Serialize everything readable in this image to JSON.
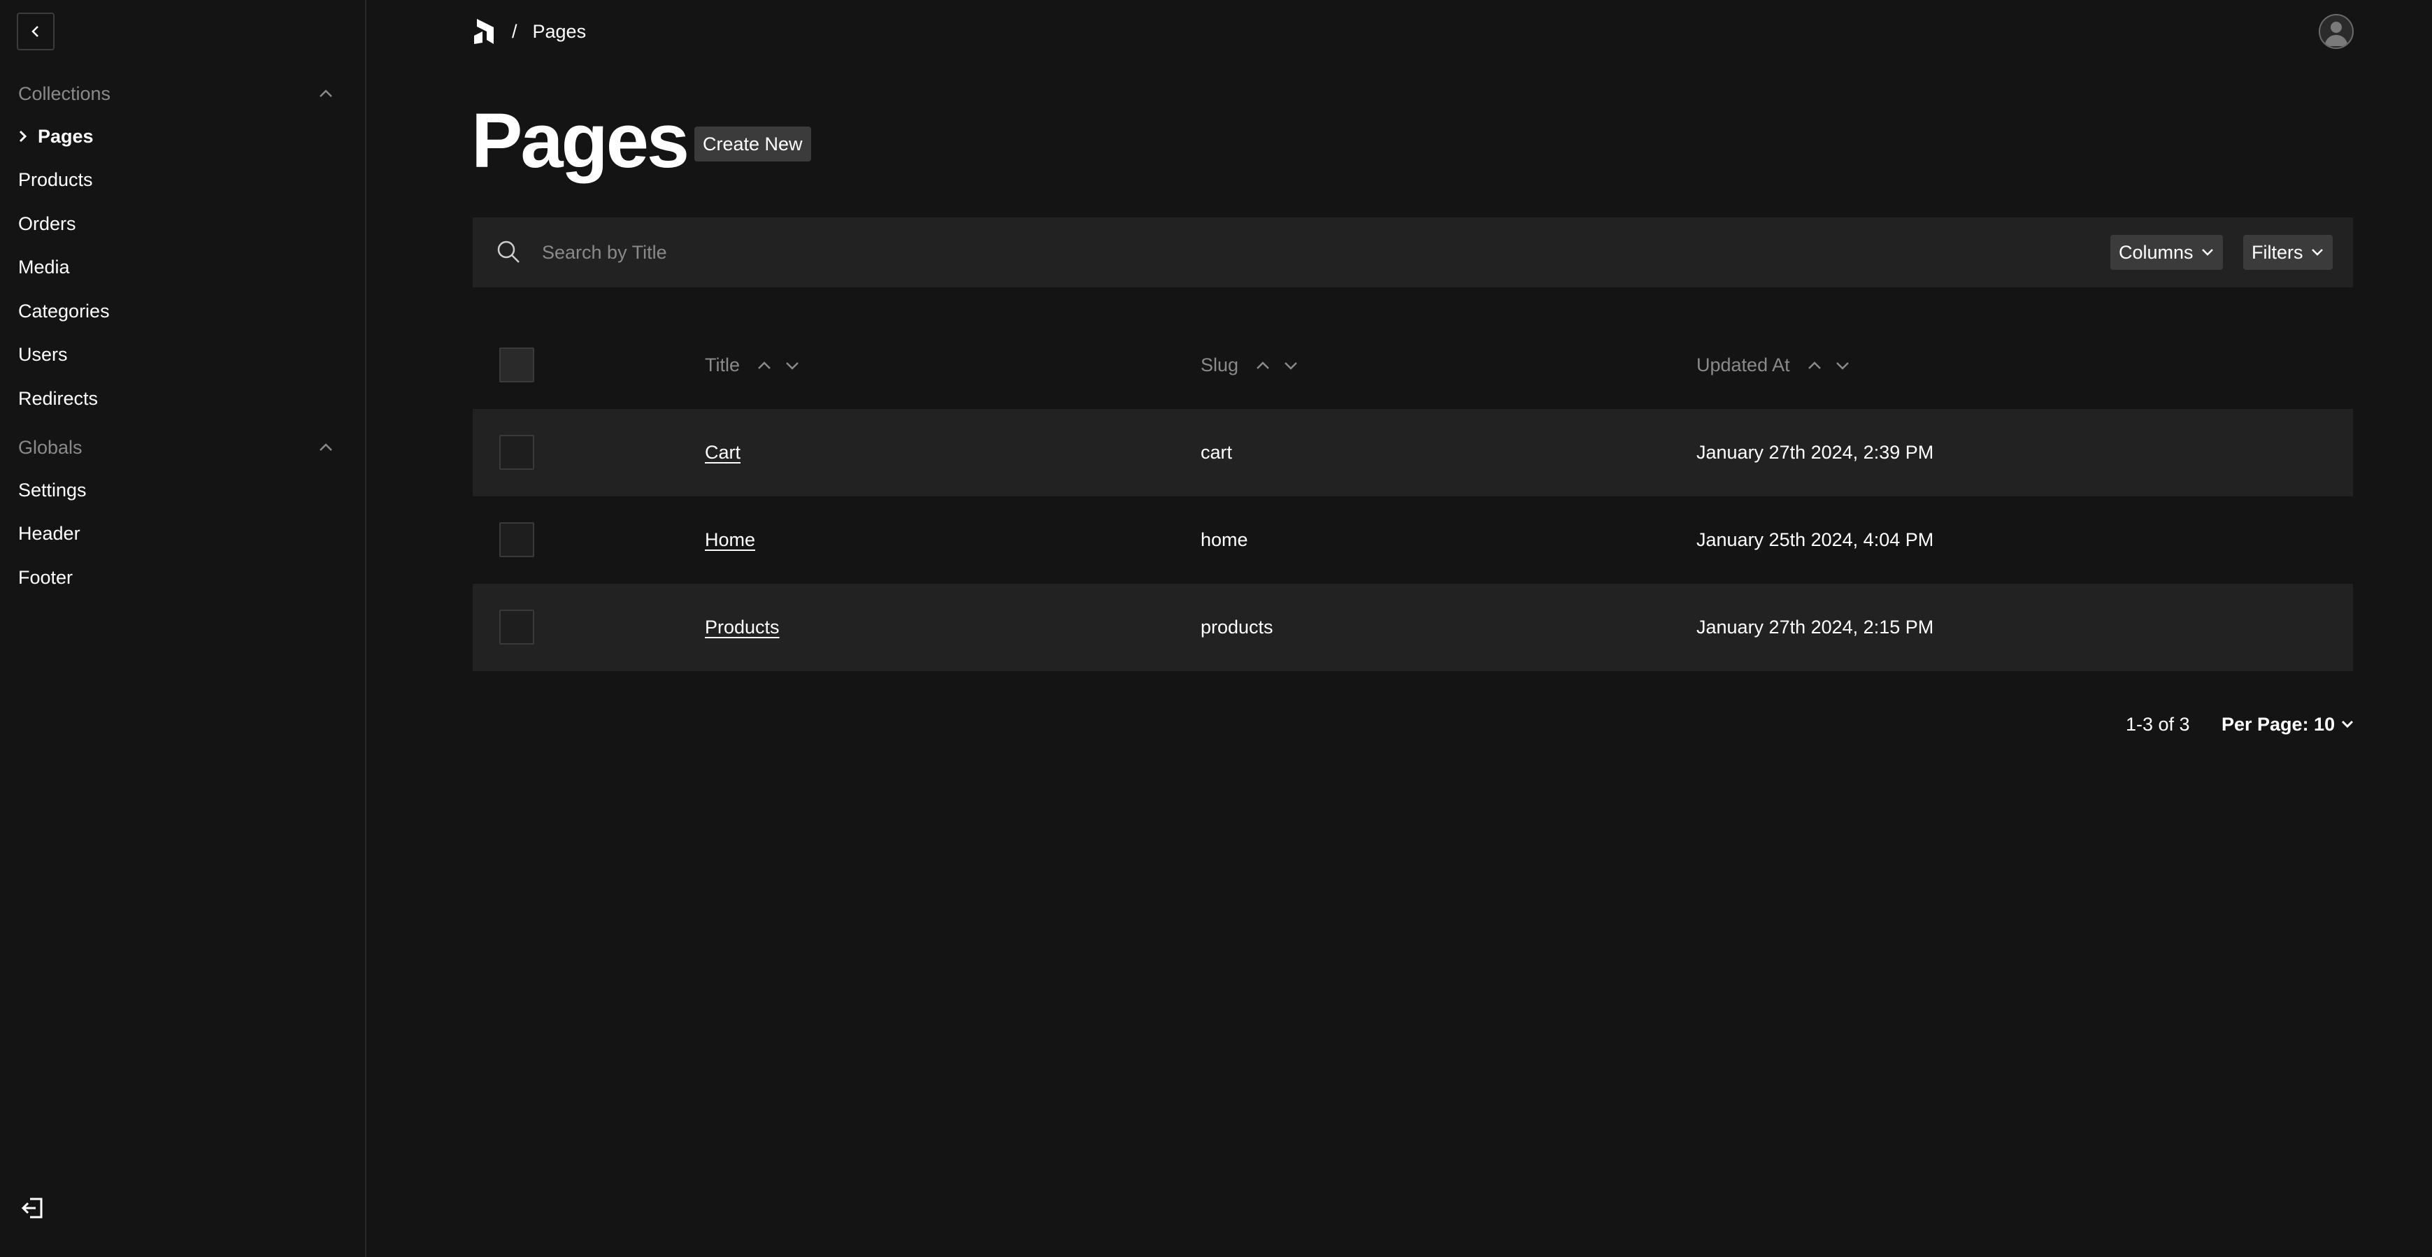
{
  "sidebar": {
    "collections_label": "Collections",
    "collections": [
      {
        "label": "Pages",
        "active": true
      },
      {
        "label": "Products"
      },
      {
        "label": "Orders"
      },
      {
        "label": "Media"
      },
      {
        "label": "Categories"
      },
      {
        "label": "Users"
      },
      {
        "label": "Redirects"
      }
    ],
    "globals_label": "Globals",
    "globals": [
      {
        "label": "Settings"
      },
      {
        "label": "Header"
      },
      {
        "label": "Footer"
      }
    ]
  },
  "breadcrumb": {
    "separator": "/",
    "current": "Pages"
  },
  "page": {
    "title": "Pages",
    "create_label": "Create New"
  },
  "search": {
    "placeholder": "Search by Title",
    "columns_label": "Columns",
    "filters_label": "Filters"
  },
  "table": {
    "headers": {
      "title": "Title",
      "slug": "Slug",
      "updated": "Updated At"
    },
    "rows": [
      {
        "title": "Cart",
        "slug": "cart",
        "updated": "January 27th 2024, 2:39 PM"
      },
      {
        "title": "Home",
        "slug": "home",
        "updated": "January 25th 2024, 4:04 PM"
      },
      {
        "title": "Products",
        "slug": "products",
        "updated": "January 27th 2024, 2:15 PM"
      }
    ]
  },
  "pagination": {
    "range": "1-3 of 3",
    "per_page": "Per Page: 10"
  }
}
